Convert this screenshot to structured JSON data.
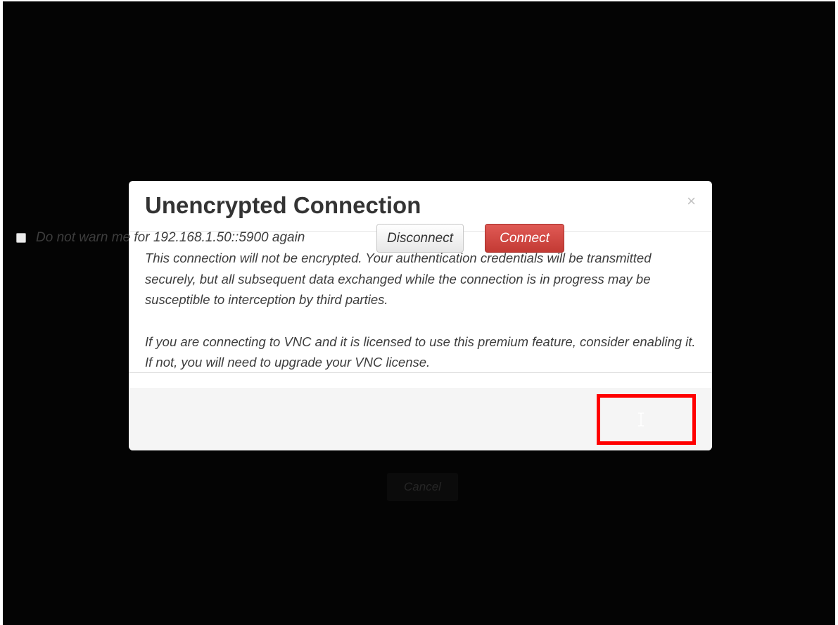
{
  "background": {
    "cancel_label": "Cancel"
  },
  "dialog": {
    "title": "Unencrypted Connection",
    "close_glyph": "×",
    "paragraphs": [
      "This connection will not be encrypted. Your authentication credentials will be transmitted securely, but all subsequent data exchanged while the connection is in progress may be susceptible to interception by third parties.",
      "If you are connecting to VNC and it is licensed to use this premium feature, consider enabling it. If not, you will need to upgrade your VNC license."
    ],
    "checkbox_label": "Do not warn me for 192.168.1.50::5900 again",
    "checkbox_checked": false,
    "disconnect_label": "Disconnect",
    "connect_label": "Connect"
  },
  "colors": {
    "backdrop": "#040404",
    "connect_button": "#d04a44",
    "highlight_box": "#ff0000"
  },
  "icons": {
    "close": "close-icon",
    "cursor": "text-cursor-icon"
  }
}
